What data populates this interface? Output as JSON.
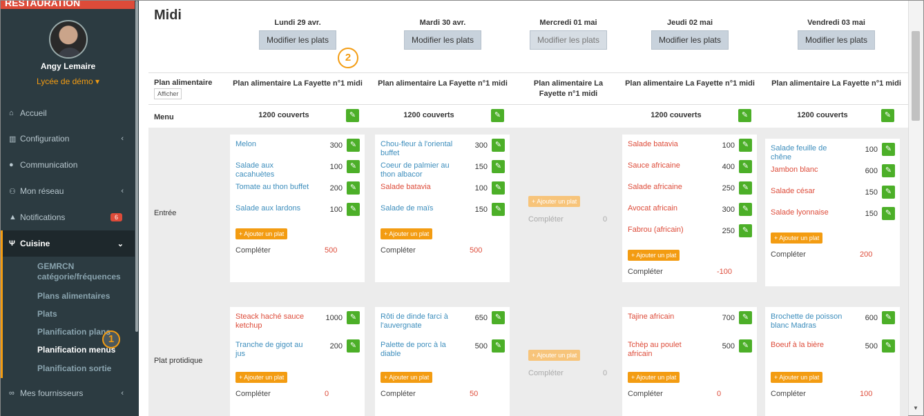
{
  "sidebar": {
    "topbar_text": "RESTAURATION",
    "user_name": "Angy Lemaire",
    "school": "Lycée de démo ▾",
    "items": [
      {
        "label": "Accueil",
        "icon": "home-icon"
      },
      {
        "label": "Configuration",
        "icon": "bank-icon"
      },
      {
        "label": "Communication",
        "icon": "comments-icon"
      },
      {
        "label": "Mon réseau",
        "icon": "sitemap-icon"
      },
      {
        "label": "Notifications",
        "icon": "bell-icon",
        "badge": "6"
      },
      {
        "label": "Cuisine",
        "icon": "cutlery-icon"
      }
    ],
    "sub_items": [
      "GEMRCN catégorie/fréquences",
      "Plans alimentaires",
      "Plats",
      "Planification plans",
      "Planification menus",
      "Planification sortie"
    ],
    "footer_item": "Mes fournisseurs"
  },
  "callouts": [
    "1",
    "2"
  ],
  "main": {
    "title": "Midi",
    "days": [
      {
        "date": "Lundi 29 avr.",
        "button": "Modifier les plats",
        "plan": "Plan alimentaire La Fayette n°1 midi",
        "covers": "1200 couverts"
      },
      {
        "date": "Mardi 30 avr.",
        "button": "Modifier les plats",
        "plan": "Plan alimentaire La Fayette n°1 midi",
        "covers": "1200 couverts"
      },
      {
        "date": "Mercredi 01 mai",
        "button": "Modifier les plats",
        "plan": "Plan alimentaire La Fayette n°1 midi",
        "covers": ""
      },
      {
        "date": "Jeudi 02 mai",
        "button": "Modifier les plats",
        "plan": "Plan alimentaire La Fayette n°1 midi",
        "covers": "1200 couverts"
      },
      {
        "date": "Vendredi 03 mai",
        "button": "Modifier les plats",
        "plan": "Plan alimentaire La Fayette n°1 midi",
        "covers": "1200 couverts"
      }
    ],
    "row_labels": {
      "plan": "Plan alimentaire",
      "show_button": "Afficher",
      "menu": "Menu",
      "entree": "Entrée",
      "plat": "Plat protidique"
    },
    "add_label": "+ Ajouter un plat",
    "complete_label": "Compléter",
    "entree": [
      {
        "dishes": [
          {
            "name": "Melon",
            "qty": "300",
            "red": false
          },
          {
            "name": "Salade aux cacahuètes",
            "qty": "100",
            "red": false
          },
          {
            "name": "Tomate au thon buffet",
            "qty": "200",
            "red": false
          },
          {
            "name": "Salade aux lardons",
            "qty": "100",
            "red": false
          }
        ],
        "complete": "500"
      },
      {
        "dishes": [
          {
            "name": "Chou-fleur à l'oriental buffet",
            "qty": "300",
            "red": false
          },
          {
            "name": "Coeur de palmier au thon albacor",
            "qty": "150",
            "red": false
          },
          {
            "name": "Salade batavia",
            "qty": "100",
            "red": true
          },
          {
            "name": "Salade de maïs",
            "qty": "150",
            "red": false
          }
        ],
        "complete": "500"
      },
      {
        "dishes": [],
        "complete": "0"
      },
      {
        "dishes": [
          {
            "name": "Salade batavia",
            "qty": "100",
            "red": true
          },
          {
            "name": "Sauce africaine",
            "qty": "400",
            "red": true
          },
          {
            "name": "Salade africaine",
            "qty": "250",
            "red": true
          },
          {
            "name": "Avocat africain",
            "qty": "300",
            "red": true
          },
          {
            "name": "Fabrou (africain)",
            "qty": "250",
            "red": true
          }
        ],
        "complete": "-100"
      },
      {
        "dishes": [
          {
            "name": "Salade feuille de chêne",
            "qty": "100",
            "red": false
          },
          {
            "name": "Jambon blanc",
            "qty": "600",
            "red": true
          },
          {
            "name": "Salade césar",
            "qty": "150",
            "red": true
          },
          {
            "name": "Salade lyonnaise",
            "qty": "150",
            "red": true
          }
        ],
        "complete": "200"
      }
    ],
    "plat": [
      {
        "dishes": [
          {
            "name": "Steack haché sauce ketchup",
            "qty": "1000",
            "red": true
          },
          {
            "name": "Tranche de gigot au jus",
            "qty": "200",
            "red": false
          }
        ],
        "complete": "0"
      },
      {
        "dishes": [
          {
            "name": "Rôti de dinde farci à l'auvergnate",
            "qty": "650",
            "red": false
          },
          {
            "name": "Palette de porc à la diable",
            "qty": "500",
            "red": false
          }
        ],
        "complete": "50"
      },
      {
        "dishes": [],
        "complete": "0"
      },
      {
        "dishes": [
          {
            "name": "Tajine africain",
            "qty": "700",
            "red": true
          },
          {
            "name": "Tchèp au poulet africain",
            "qty": "500",
            "red": true
          }
        ],
        "complete": "0"
      },
      {
        "dishes": [
          {
            "name": "Brochette de poisson blanc Madras",
            "qty": "600",
            "red": false
          },
          {
            "name": "Boeuf à la bière",
            "qty": "500",
            "red": true
          }
        ],
        "complete": "100"
      }
    ]
  }
}
